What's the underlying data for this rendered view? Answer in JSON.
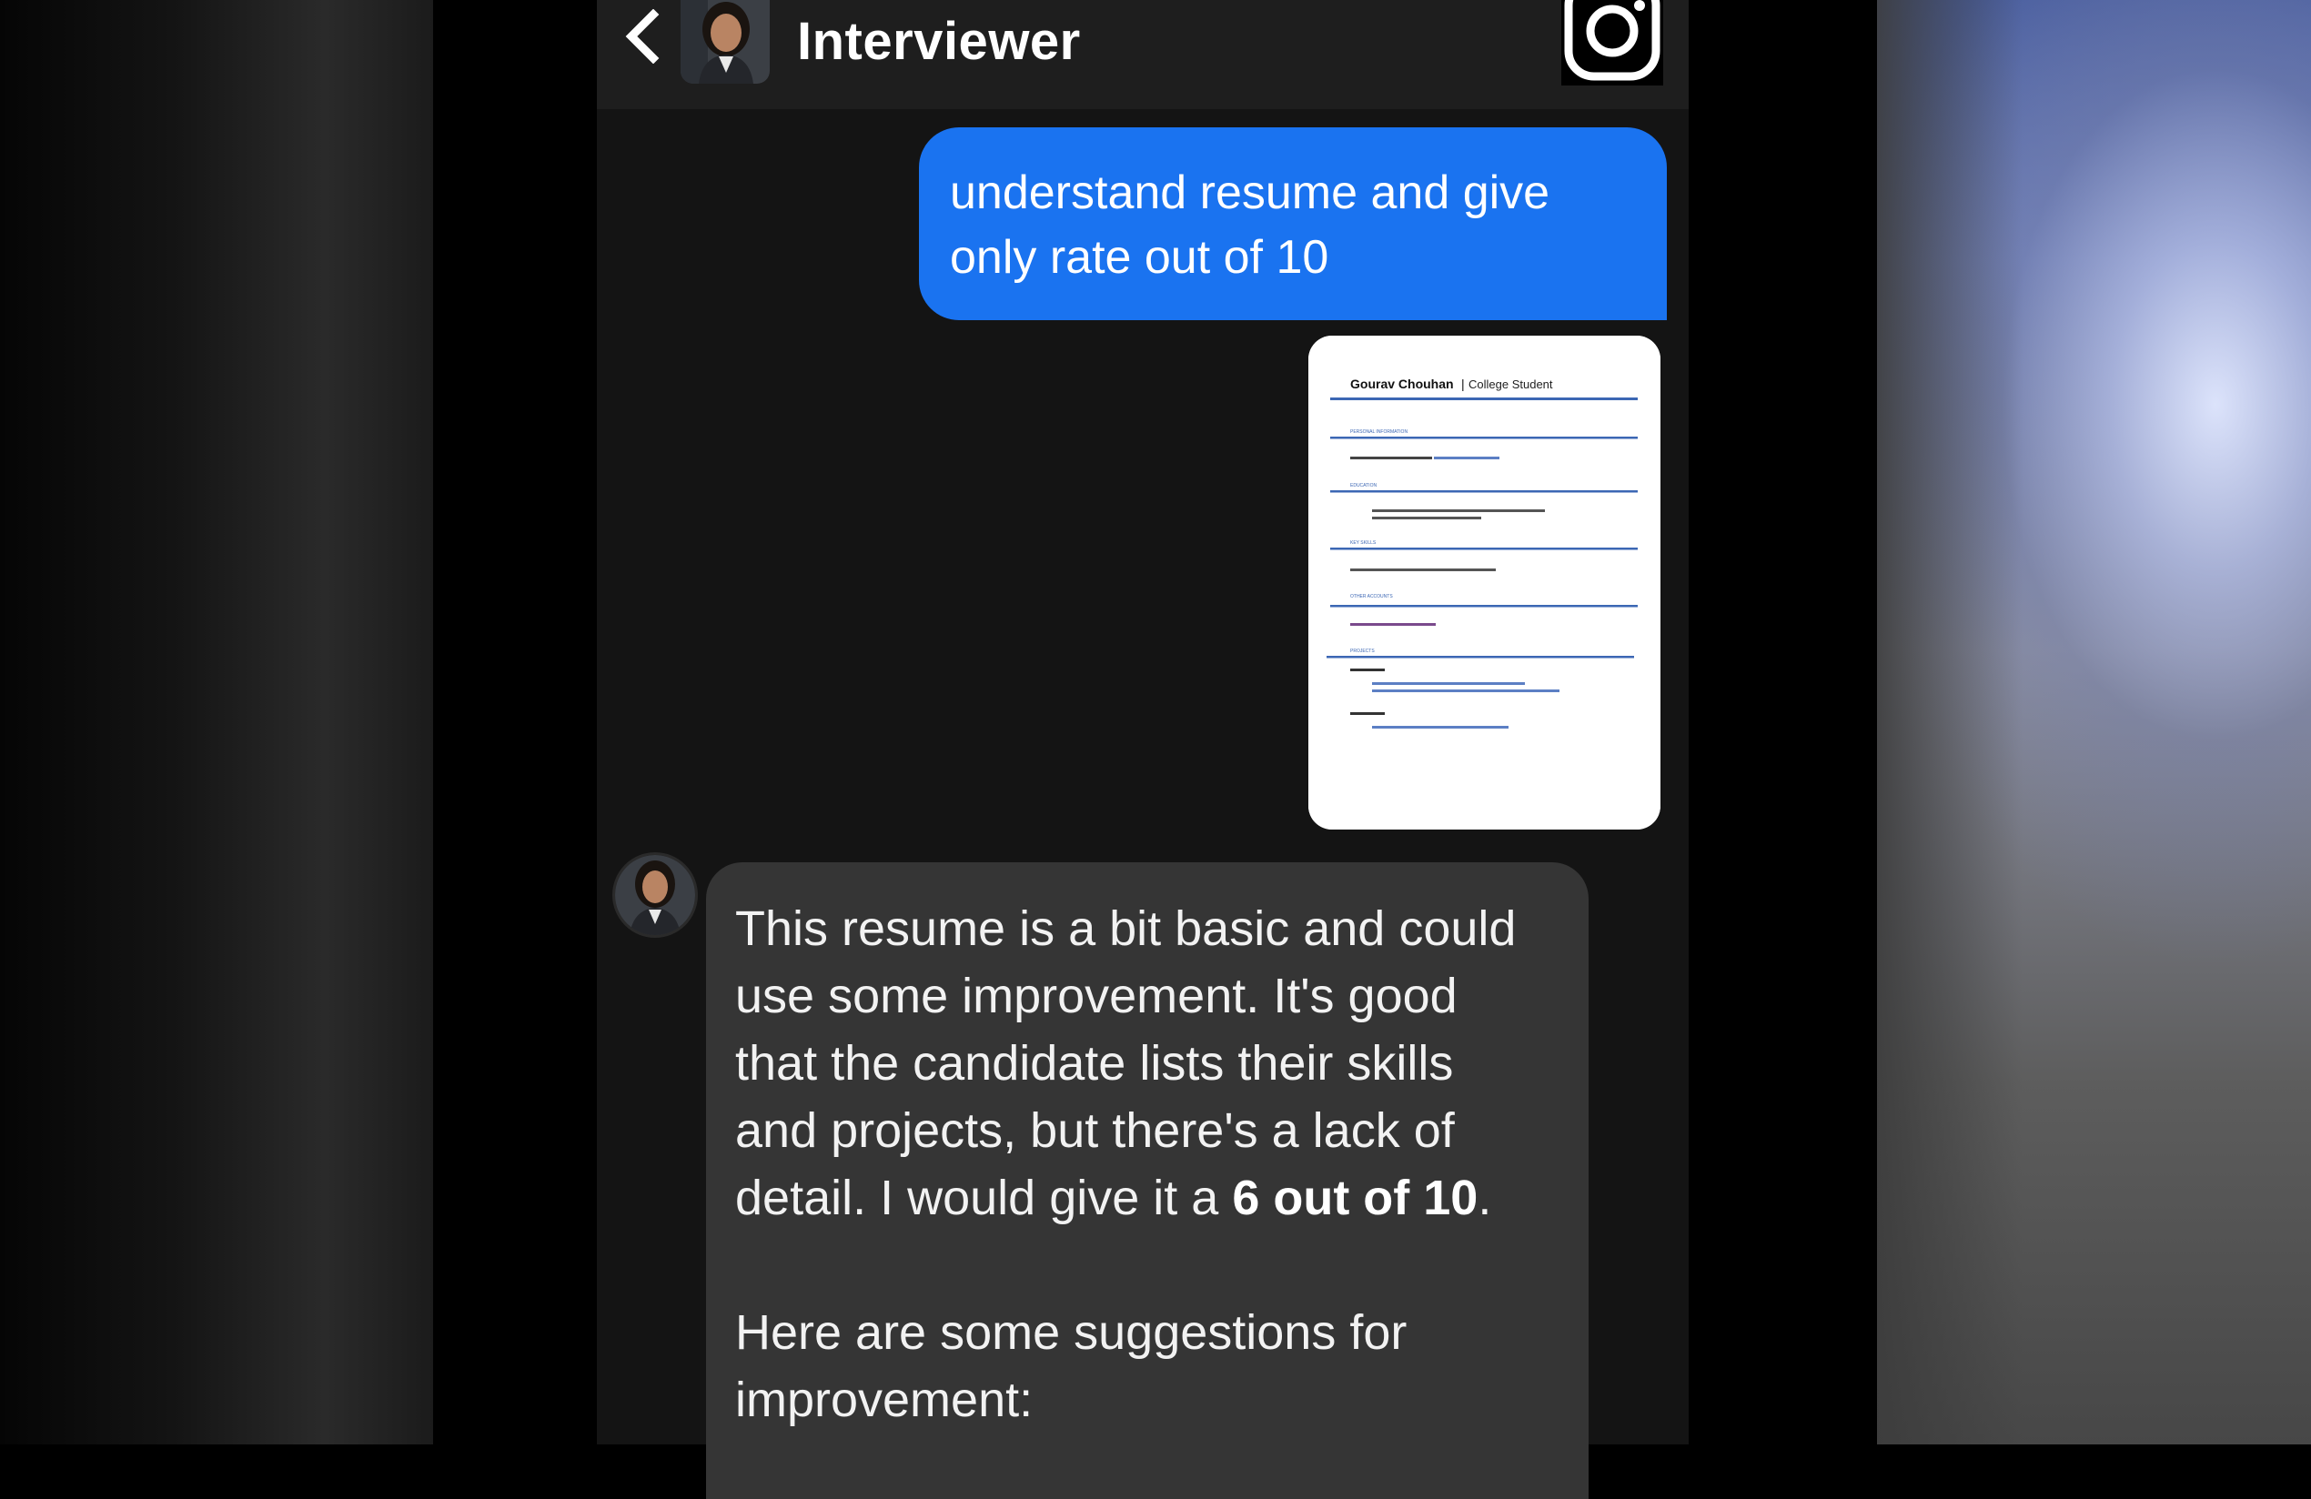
{
  "header": {
    "title": "Interviewer",
    "back_icon": "chevron-left-icon",
    "social_icon": "instagram-icon"
  },
  "messages": {
    "user_text": "understand resume and give only rate out of 10",
    "attachment": {
      "name": "Gourav Chouhan",
      "role": "College Student",
      "sections": [
        "PERSONAL INFORMATION",
        "EDUCATION",
        "KEY SKILLS",
        "OTHER ACCOUNTS",
        "PROJECTS"
      ]
    },
    "bot": {
      "lines": [
        "This resume is a bit basic and could",
        "use some improvement. It's good",
        "that the candidate lists their skills",
        "and projects, but there's a lack of"
      ],
      "last_line_prefix": "detail.  I would give it a ",
      "rating": "6 out of 10",
      "last_line_suffix": ".",
      "suggestions_intro_1": "Here are some suggestions for",
      "suggestions_intro_2": "improvement:"
    }
  },
  "colors": {
    "user_bubble": "#1a73f0",
    "bot_bubble": "#353535",
    "chat_bg": "#141414",
    "header_bg": "#1e1e1e"
  }
}
